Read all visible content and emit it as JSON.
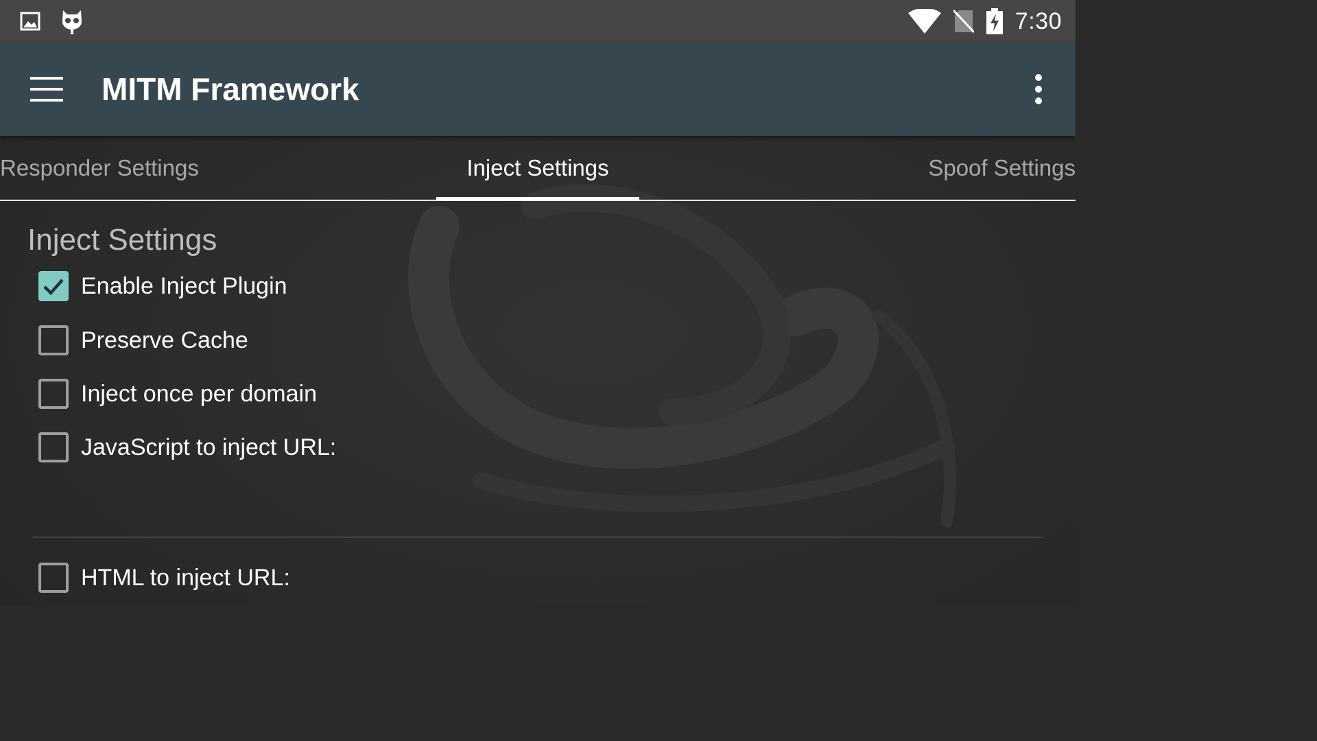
{
  "status_bar": {
    "time": "7:30",
    "icons": [
      "image-icon",
      "cyanogen-mascot-icon",
      "wifi-icon",
      "no-sim-icon",
      "battery-charging-icon"
    ]
  },
  "app_bar": {
    "title": "MITM Framework",
    "background": "#37474f"
  },
  "tabs": [
    {
      "label": "Responder Settings",
      "selected": false
    },
    {
      "label": "Inject Settings",
      "selected": true
    },
    {
      "label": "Spoof Settings",
      "selected": false
    }
  ],
  "section": {
    "title": "Inject Settings",
    "items": [
      {
        "label": "Enable Inject Plugin",
        "checked": true
      },
      {
        "label": "Preserve Cache",
        "checked": false
      },
      {
        "label": "Inject once per domain",
        "checked": false
      },
      {
        "label": "JavaScript to inject URL:",
        "checked": false
      },
      {
        "label": "HTML to inject URL:",
        "checked": false
      }
    ]
  },
  "colors": {
    "accent": "#80cbc4",
    "app_bar": "#37474f",
    "status_bar": "#464646",
    "background": "#2b2b2b"
  }
}
